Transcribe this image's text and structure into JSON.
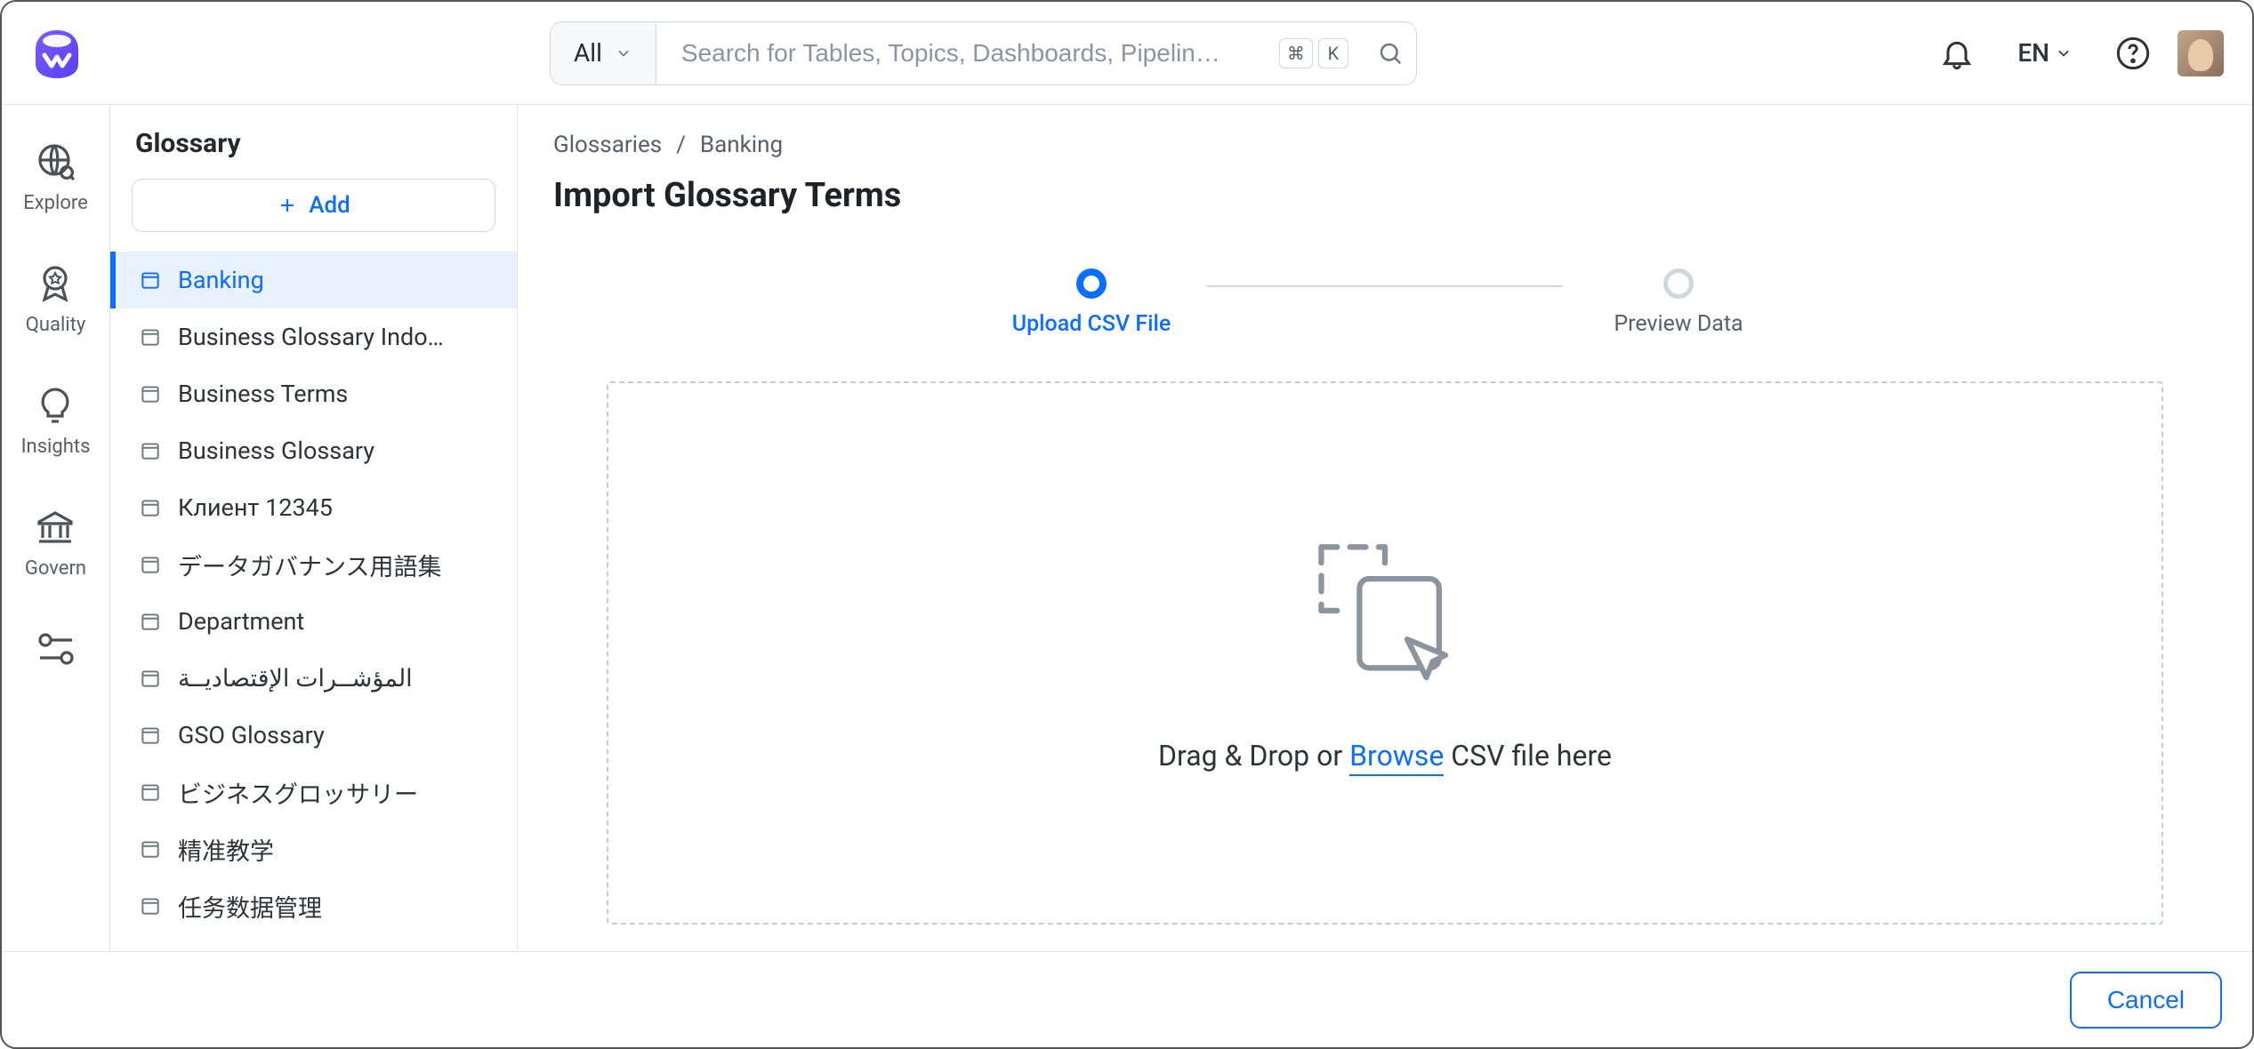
{
  "topbar": {
    "search_filter_label": "All",
    "search_placeholder": "Search for Tables, Topics, Dashboards, Pipelin…",
    "kbd_cmd": "⌘",
    "kbd_k": "K",
    "language": "EN"
  },
  "navrail": {
    "items": [
      {
        "id": "explore",
        "label": "Explore",
        "icon": "globe-search"
      },
      {
        "id": "quality",
        "label": "Quality",
        "icon": "badge"
      },
      {
        "id": "insights",
        "label": "Insights",
        "icon": "lightbulb"
      },
      {
        "id": "govern",
        "label": "Govern",
        "icon": "institution"
      },
      {
        "id": "settings",
        "label": "",
        "icon": "nodes"
      }
    ]
  },
  "sidebar": {
    "title": "Glossary",
    "add_label": "Add",
    "items": [
      {
        "label": "Banking",
        "active": true
      },
      {
        "label": "Business Glossary Indo…",
        "active": false
      },
      {
        "label": "Business Terms",
        "active": false
      },
      {
        "label": "Business Glossary",
        "active": false
      },
      {
        "label": "Клиент 12345",
        "active": false
      },
      {
        "label": "データガバナンス用語集",
        "active": false
      },
      {
        "label": "Department",
        "active": false
      },
      {
        "label": "المؤشــرات الإقتصاديــة",
        "active": false
      },
      {
        "label": "GSO Glossary",
        "active": false
      },
      {
        "label": "ビジネスグロッサリー",
        "active": false
      },
      {
        "label": "精准教学",
        "active": false
      },
      {
        "label": "任务数据管理",
        "active": false
      }
    ]
  },
  "breadcrumb": {
    "items": [
      "Glossaries",
      "Banking"
    ],
    "separator": "/"
  },
  "page": {
    "title": "Import Glossary Terms"
  },
  "stepper": {
    "steps": [
      {
        "label": "Upload CSV File",
        "state": "active"
      },
      {
        "label": "Preview Data",
        "state": "inactive"
      }
    ]
  },
  "dropzone": {
    "text_prefix": "Drag & Drop or ",
    "browse_label": "Browse",
    "text_suffix": " CSV file here"
  },
  "footer": {
    "cancel_label": "Cancel"
  }
}
